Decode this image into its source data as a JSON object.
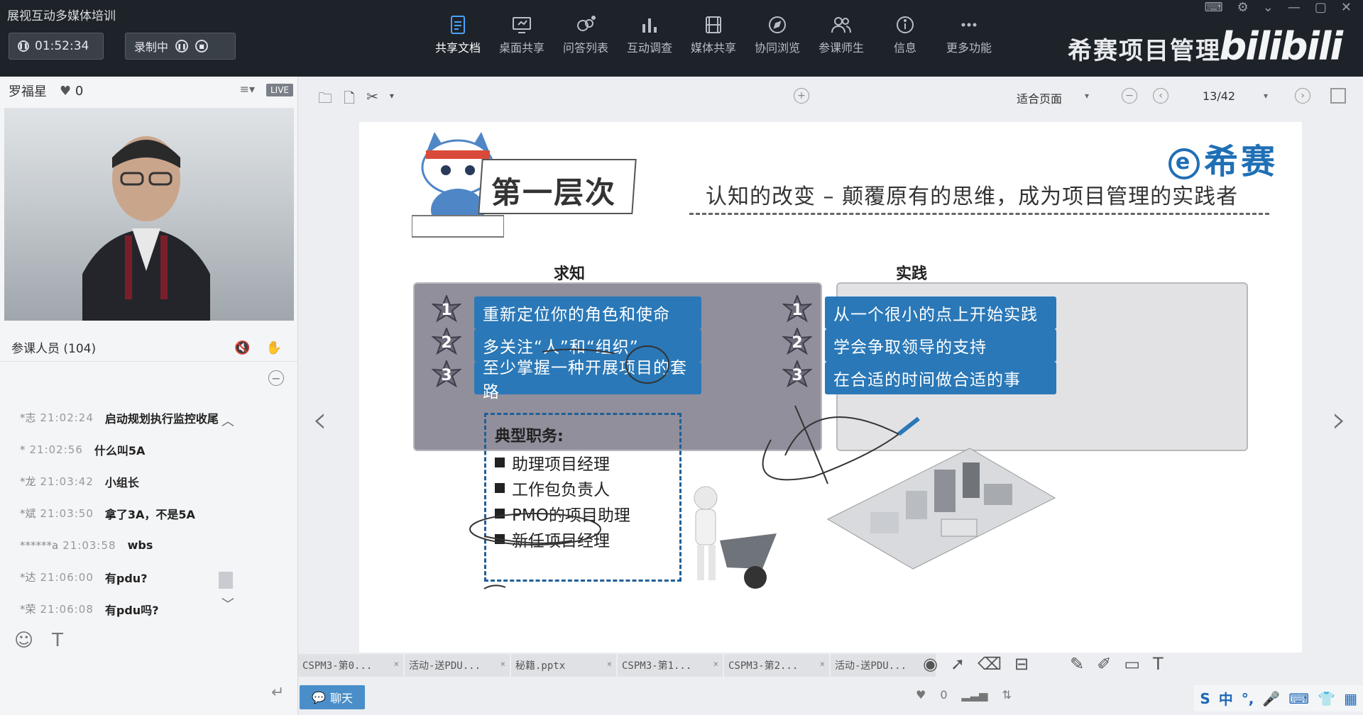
{
  "app": {
    "title": "展视互动多媒体培训",
    "timer": "01:52:34",
    "recording_label": "录制中"
  },
  "toolbar": {
    "items": [
      {
        "label": "共享文档",
        "icon": "share-doc-icon",
        "active": true
      },
      {
        "label": "桌面共享",
        "icon": "desktop-share-icon",
        "active": false
      },
      {
        "label": "问答列表",
        "icon": "qa-list-icon",
        "active": false
      },
      {
        "label": "互动调查",
        "icon": "survey-icon",
        "active": false
      },
      {
        "label": "媒体共享",
        "icon": "media-share-icon",
        "active": false
      },
      {
        "label": "协同浏览",
        "icon": "co-browse-icon",
        "active": false
      },
      {
        "label": "参课师生",
        "icon": "participants-icon",
        "active": false
      },
      {
        "label": "信息",
        "icon": "info-icon",
        "active": false
      },
      {
        "label": "更多功能",
        "icon": "more-icon",
        "active": false
      }
    ]
  },
  "brand": {
    "name": "希赛项目管理",
    "site": "bilibili"
  },
  "presenter": {
    "name": "罗福星",
    "likes": "0",
    "live_badge": "LIVE"
  },
  "attendees": {
    "label": "参课人员 (104)"
  },
  "chat": {
    "messages": [
      {
        "who": "*志",
        "time": "21:02:24",
        "text": "启动规划执行监控收尾"
      },
      {
        "who": "*",
        "time": "21:02:56",
        "text": "什么叫5A"
      },
      {
        "who": "*龙",
        "time": "21:03:42",
        "text": "小组长"
      },
      {
        "who": "*斌",
        "time": "21:03:50",
        "text": "拿了3A，不是5A"
      },
      {
        "who": "******a",
        "time": "21:03:58",
        "text": "wbs"
      },
      {
        "who": "*达",
        "time": "21:06:00",
        "text": "有pdu?"
      },
      {
        "who": "*荣",
        "time": "21:06:08",
        "text": "有pdu吗?"
      }
    ],
    "chat_button": "聊天"
  },
  "doc_toolbar": {
    "fit_label": "适合页面",
    "page_indicator": "13/42"
  },
  "slide": {
    "logo_text": "希赛",
    "title": "第一层次",
    "subtitle": "认知的改变 – 颠覆原有的思维，成为项目管理的实践者",
    "left_heading": "求知",
    "right_heading": "实践",
    "left_items": [
      "重新定位你的角色和使命",
      "多关注“人”和“组织”",
      "至少掌握一种开展项目的套路"
    ],
    "right_items": [
      "从一个很小的点上开始实践",
      "学会争取领导的支持",
      "在合适的时间做合适的事"
    ],
    "duties_title": "典型职务:",
    "duties": [
      "助理项目经理",
      "工作包负责人",
      "PMO的项目助理",
      "新任项目经理"
    ],
    "numbers": [
      "1",
      "2",
      "3"
    ]
  },
  "doc_tabs": [
    "CSPM3-第0...",
    "活动-送PDU...",
    "秘籍.pptx",
    "CSPM3-第1...",
    "CSPM3-第2...",
    "活动-送PDU..."
  ],
  "status": {
    "likes": "0",
    "ime": "中"
  }
}
